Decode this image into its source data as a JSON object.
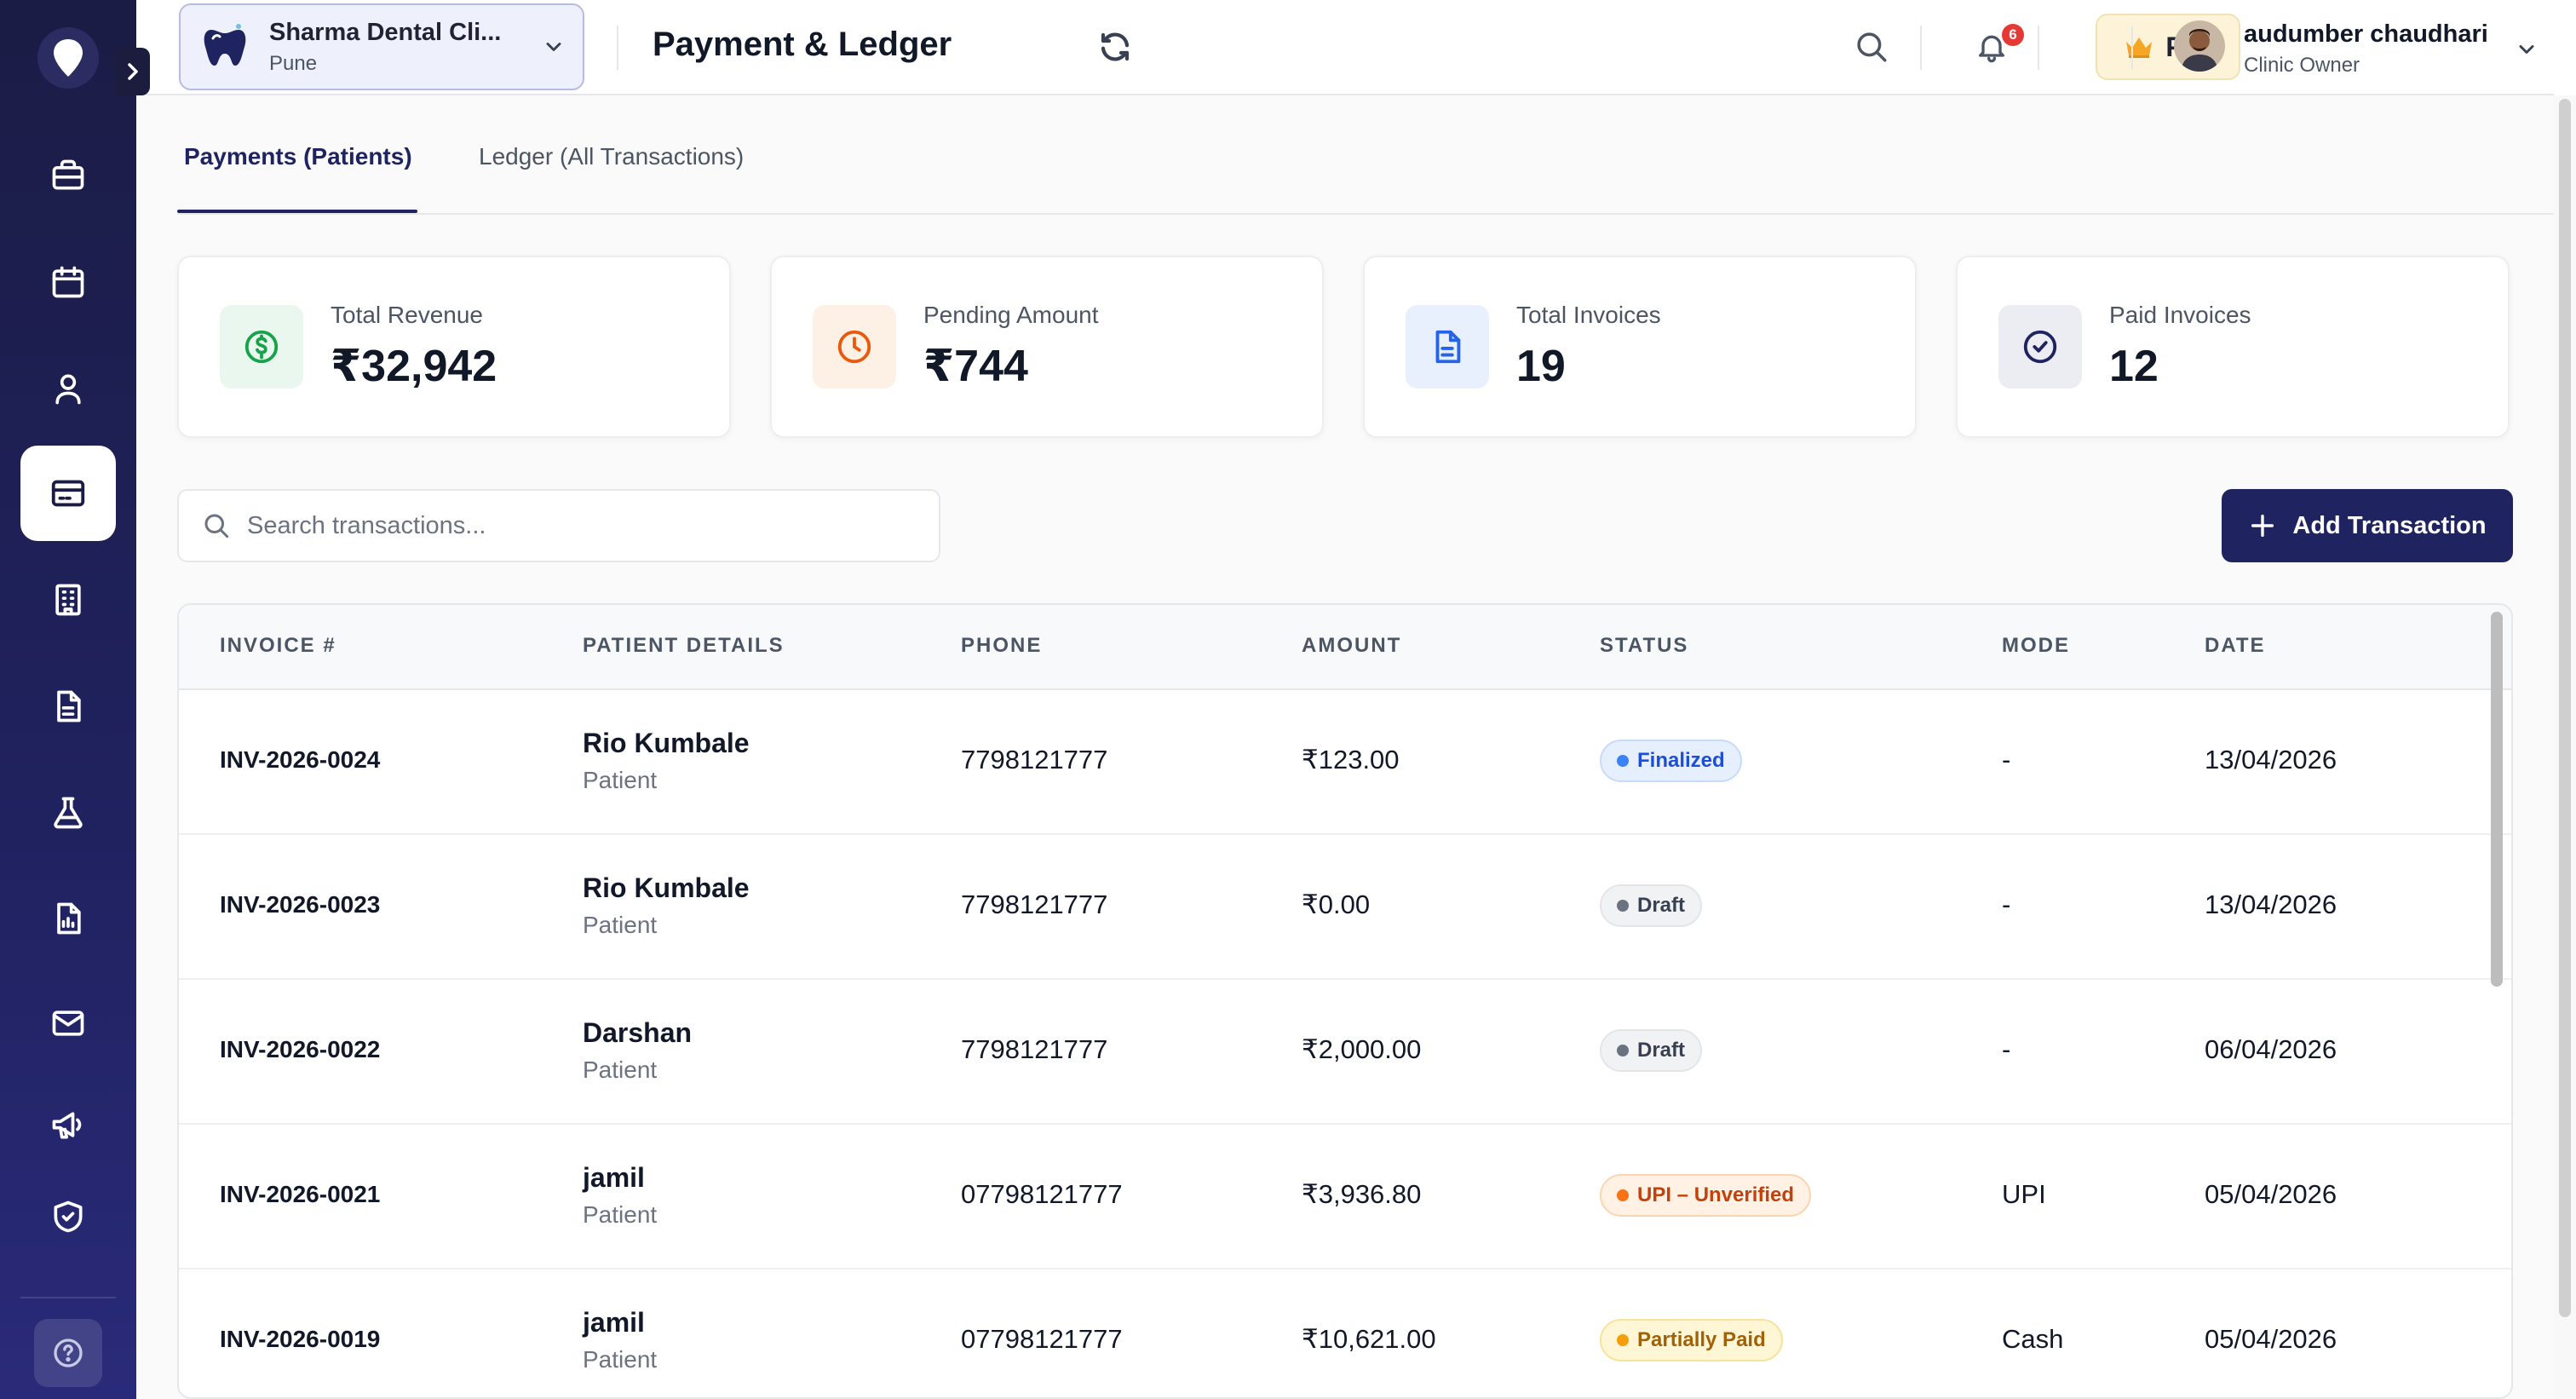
{
  "header": {
    "clinic_name": "Sharma Dental Cli...",
    "clinic_city": "Pune",
    "page_title": "Payment & Ledger",
    "notification_count": "6",
    "plan_label": "Pro",
    "user_name": "audumber chaudhari",
    "user_role": "Clinic Owner"
  },
  "sidebar": {
    "items": [
      {
        "name": "dashboard",
        "icon": "briefcase-icon",
        "active": false
      },
      {
        "name": "appointments",
        "icon": "calendar-icon",
        "active": false
      },
      {
        "name": "patients",
        "icon": "user-icon",
        "active": false
      },
      {
        "name": "payments",
        "icon": "credit-card-icon",
        "active": true
      },
      {
        "name": "clinic",
        "icon": "building-icon",
        "active": false
      },
      {
        "name": "documents",
        "icon": "document-icon",
        "active": false
      },
      {
        "name": "lab",
        "icon": "flask-icon",
        "active": false
      },
      {
        "name": "reports",
        "icon": "report-icon",
        "active": false
      },
      {
        "name": "messages",
        "icon": "mail-icon",
        "active": false
      },
      {
        "name": "marketing",
        "icon": "megaphone-icon",
        "active": false
      },
      {
        "name": "security",
        "icon": "shield-icon",
        "active": false
      }
    ]
  },
  "tabs": [
    {
      "label": "Payments (Patients)",
      "active": true
    },
    {
      "label": "Ledger (All Transactions)",
      "active": false
    }
  ],
  "stats": [
    {
      "label": "Total Revenue",
      "value": "₹32,942",
      "icon": "dollar-circle-icon",
      "color": "#16a34a"
    },
    {
      "label": "Pending Amount",
      "value": "₹744",
      "icon": "clock-icon",
      "color": "#ea580c"
    },
    {
      "label": "Total Invoices",
      "value": "19",
      "icon": "document-icon",
      "color": "#2563eb"
    },
    {
      "label": "Paid Invoices",
      "value": "12",
      "icon": "check-circle-icon",
      "color": "#1f2460"
    }
  ],
  "search": {
    "placeholder": "Search transactions..."
  },
  "add_button_label": "Add Transaction",
  "table": {
    "columns": [
      "INVOICE #",
      "PATIENT DETAILS",
      "PHONE",
      "AMOUNT",
      "STATUS",
      "MODE",
      "DATE"
    ],
    "rows": [
      {
        "invoice": "INV-2026-0024",
        "patient": "Rio Kumbale",
        "patient_type": "Patient",
        "phone": "7798121777",
        "amount": "₹123.00",
        "status": "Finalized",
        "mode": "-",
        "date": "13/04/2026"
      },
      {
        "invoice": "INV-2026-0023",
        "patient": "Rio Kumbale",
        "patient_type": "Patient",
        "phone": "7798121777",
        "amount": "₹0.00",
        "status": "Draft",
        "mode": "-",
        "date": "13/04/2026"
      },
      {
        "invoice": "INV-2026-0022",
        "patient": "Darshan",
        "patient_type": "Patient",
        "phone": "7798121777",
        "amount": "₹2,000.00",
        "status": "Draft",
        "mode": "-",
        "date": "06/04/2026"
      },
      {
        "invoice": "INV-2026-0021",
        "patient": "jamil",
        "patient_type": "Patient",
        "phone": "07798121777",
        "amount": "₹3,936.80",
        "status": "UPI – Unverified",
        "mode": "UPI",
        "date": "05/04/2026"
      },
      {
        "invoice": "INV-2026-0019",
        "patient": "jamil",
        "patient_type": "Patient",
        "phone": "07798121777",
        "amount": "₹10,621.00",
        "status": "Partially Paid",
        "mode": "Cash",
        "date": "05/04/2026"
      }
    ]
  },
  "status_colors": {
    "Finalized": {
      "bg": "#e6effd",
      "border": "#c9dbfa",
      "text": "#1d4ed8",
      "dot": "#3b82f6"
    },
    "Draft": {
      "bg": "#f1f2f4",
      "border": "#e3e5e8",
      "text": "#374151",
      "dot": "#6b7280"
    },
    "UPI – Unverified": {
      "bg": "#fff1e4",
      "border": "#fbd5b0",
      "text": "#c2410c",
      "dot": "#f97316"
    },
    "Partially Paid": {
      "bg": "#fff6d6",
      "border": "#f7e39c",
      "text": "#a16207",
      "dot": "#f59e0b"
    }
  }
}
